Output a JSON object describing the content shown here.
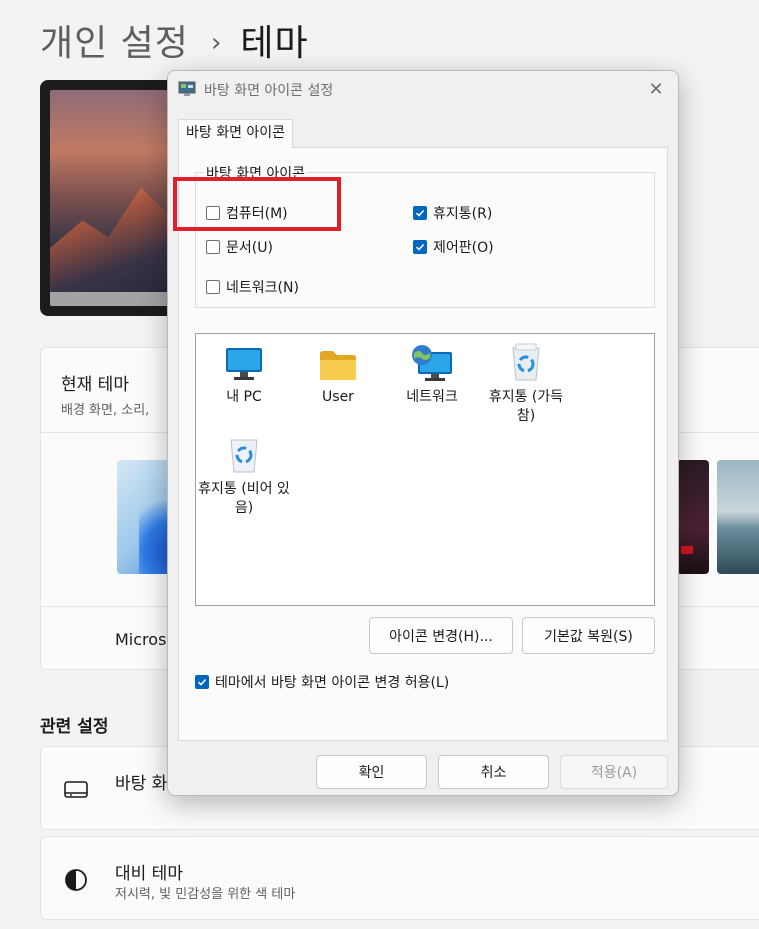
{
  "settings": {
    "breadcrumb_parent": "개인 설정",
    "breadcrumb_sep": "›",
    "breadcrumb_current": "테마",
    "current_theme": {
      "title": "현재 테마",
      "subtitle": "배경 화면, 소리,",
      "label": "Micros"
    },
    "related_title": "관련 설정",
    "rows": [
      {
        "title": "바탕 화면 아이콘 설정",
        "subtitle": "",
        "icon": "monitor-icon"
      },
      {
        "title": "대비 테마",
        "subtitle": "저시력, 빛 민감성을 위한 색 테마",
        "icon": "contrast-icon"
      }
    ]
  },
  "dialog": {
    "title": "바탕 화면 아이콘 설정",
    "close_glyph": "✕",
    "tab_label": "바탕 화면 아이콘",
    "group_legend": "바탕 화면 아이콘",
    "checkboxes": [
      {
        "label": "컴퓨터(M)",
        "checked": false
      },
      {
        "label": "휴지통(R)",
        "checked": true
      },
      {
        "label": "문서(U)",
        "checked": false
      },
      {
        "label": "제어판(O)",
        "checked": true
      },
      {
        "label": "네트워크(N)",
        "checked": false
      }
    ],
    "icons": [
      {
        "label": "내 PC",
        "icon": "pc-monitor-icon"
      },
      {
        "label": "User",
        "icon": "folder-icon"
      },
      {
        "label": "네트워크",
        "icon": "network-globe-icon"
      },
      {
        "label": "휴지통 (가득 참)",
        "icon": "recycle-bin-full-icon"
      },
      {
        "label": "휴지통 (비어 있음)",
        "icon": "recycle-bin-empty-icon"
      }
    ],
    "change_icon_button": "아이콘 변경(H)...",
    "restore_default_button": "기본값 복원(S)",
    "allow_themes_label": "테마에서 바탕 화면 아이콘 변경 허용(L)",
    "allow_themes_checked": true,
    "ok_button": "확인",
    "cancel_button": "취소",
    "apply_button": "적용(A)",
    "accent_color": "#0067c0",
    "highlight_color": "#e0202a"
  }
}
